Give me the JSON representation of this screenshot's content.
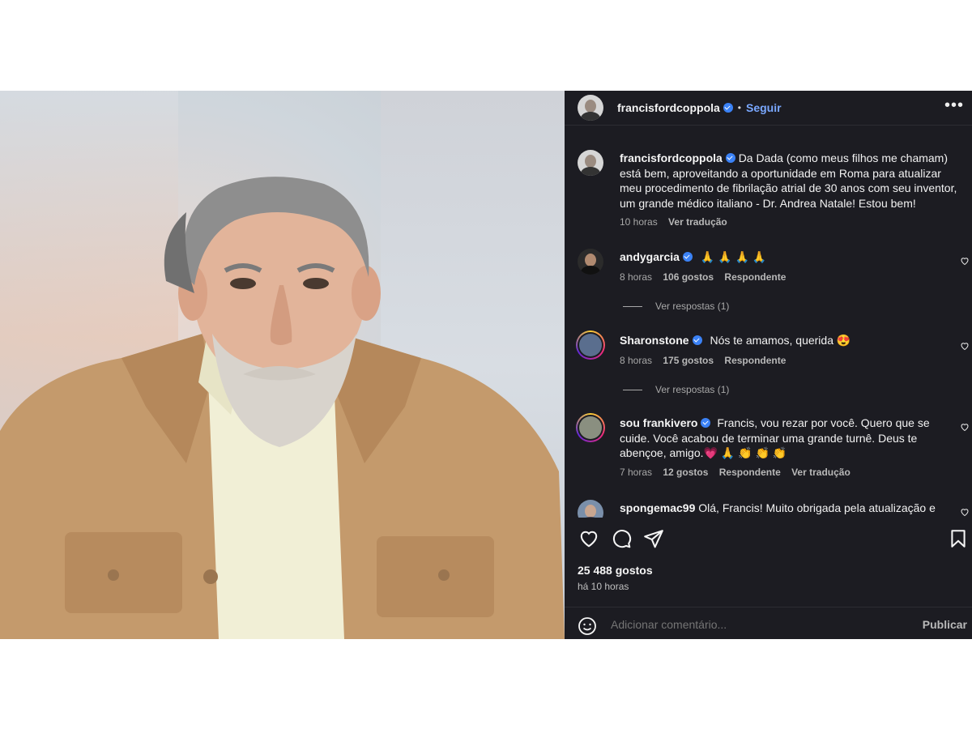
{
  "post": {
    "author": "francisfordcoppola",
    "follow_label": "Seguir",
    "separator": "•",
    "more_label": "•••",
    "image_alt": "Francis Ford Coppola"
  },
  "caption": {
    "username": "francisfordcoppola",
    "text": "Da Dada (como meus filhos me chamam) está bem, aproveitando a oportunidade em Roma para atualizar meu procedimento de fibrilação atrial de 30 anos com seu inventor, um grande médico italiano - Dr. Andrea Natale! Estou bem!",
    "time": "10 horas",
    "translate": "Ver tradução"
  },
  "comments": [
    {
      "username": "andygarcia",
      "text": "🙏 🙏 🙏 🙏",
      "time": "8 horas",
      "likes": "106 gostos",
      "reply": "Respondente",
      "replies": "Ver respostas (1)"
    },
    {
      "username": "Sharonstone",
      "text": "Nós te amamos, querida 😍",
      "time": "8 horas",
      "likes": "175 gostos",
      "reply": "Respondente",
      "replies": "Ver respostas (1)"
    },
    {
      "username": "sou frankivero",
      "text": "Francis, vou rezar por você. Quero que se cuide. Você acabou de terminar uma grande turnê. Deus te abençoe, amigo.💗 🙏 👏 👏 👏",
      "time": "7 horas",
      "likes": "12 gostos",
      "reply": "Respondente",
      "translate": "Ver tradução"
    },
    {
      "username": "spongemac99",
      "text": "Olá, Francis! Muito obrigada pela atualização e"
    }
  ],
  "stats": {
    "likes": "25 488 gostos",
    "ago": "há 10 horas"
  },
  "composer": {
    "placeholder": "Adicionar comentário...",
    "publish_label": "Publicar"
  },
  "icons": [
    "like-icon",
    "comment-icon",
    "share-icon",
    "save-icon",
    "emoji-icon",
    "verified-icon",
    "heart-icon",
    "more-icon"
  ],
  "colors": {
    "panel_bg": "#1c1c22",
    "link_blue": "#7aa8ff",
    "verified": "#3b82f6",
    "muted": "#a8a8a8"
  }
}
